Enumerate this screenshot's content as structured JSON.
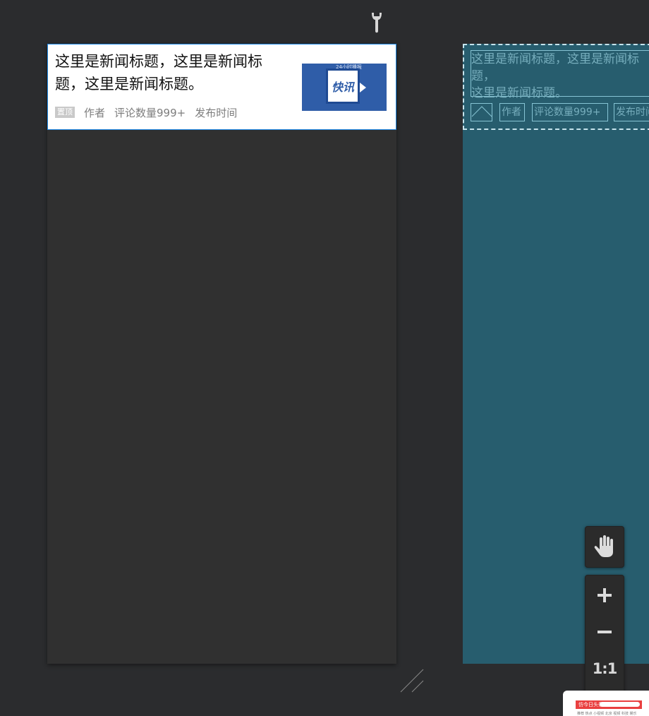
{
  "news_card": {
    "title": "这里是新闻标题，这里是新闻标题，这里是新闻标题。",
    "badge": "置顶",
    "author": "作者",
    "comments": "评论数量999+",
    "time": "发布时间",
    "thumbnail": {
      "small_text": "24小时播报",
      "main_text": "快讯"
    }
  },
  "preview": {
    "title": "这里是新闻标题，这里是新闻标题，\n这里是新闻标题。",
    "author": "作者",
    "comments": "评论数量999+",
    "time": "发布时间"
  },
  "zoom": {
    "reset_label": "1:1"
  },
  "minimap": {
    "logo": "仿今日头条",
    "tabs": "推荐  热点  小视频  北京  视频  科技  娱乐"
  },
  "colors": {
    "canvas_bg": "#2b2c2e",
    "selection_border": "#1e88e5",
    "preview_bg": "#275d6e",
    "thumbnail_bg": "#2f5da8"
  },
  "icons": [
    "wrench-icon",
    "hand-icon",
    "plus-icon",
    "minus-icon",
    "resize-handle-icon"
  ]
}
